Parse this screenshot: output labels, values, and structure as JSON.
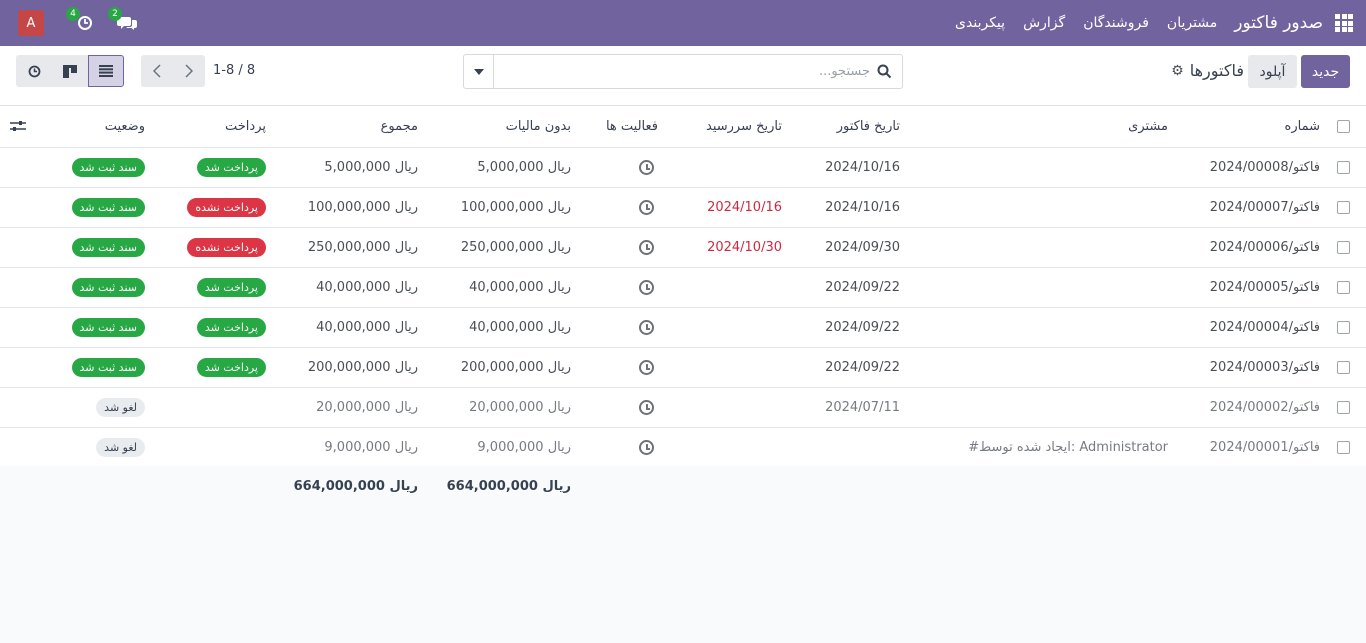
{
  "navbar": {
    "brand": "صدور فاکتور",
    "menu": [
      "مشتریان",
      "فروشندگان",
      "گزارش",
      "پیکربندی"
    ],
    "avatar_letter": "A",
    "activity_count": "4",
    "chat_count": "2",
    "bg_color": "#71639e"
  },
  "control": {
    "new_label": "جدید",
    "upload_label": "آپلود",
    "breadcrumb": "فاکتورها",
    "search_placeholder": "جستجو...",
    "pager": "1-8 / 8"
  },
  "table": {
    "headers": {
      "number": "شماره",
      "customer": "مشتری",
      "invoice_date": "تاریخ فاکتور",
      "due_date": "تاریخ سررسید",
      "activities": "فعالیت ها",
      "untaxed": "بدون مالیات",
      "total": "مجموع",
      "payment": "پرداخت",
      "status": "وضعیت"
    },
    "rows": [
      {
        "number": "فاکتو/2024/00008",
        "customer": "",
        "invoice_date": "2024/10/16",
        "due_date": "",
        "untaxed": "ریال 5,000,000",
        "total": "ریال 5,000,000",
        "payment": "پرداخت شد",
        "status": "سند ثبت شد"
      },
      {
        "number": "فاکتو/2024/00007",
        "customer": "",
        "invoice_date": "2024/10/16",
        "due_date": "2024/10/16",
        "untaxed": "ریال 100,000,000",
        "total": "ریال 100,000,000",
        "payment": "پرداخت نشده",
        "status": "سند ثبت شد"
      },
      {
        "number": "فاکتو/2024/00006",
        "customer": "",
        "invoice_date": "2024/09/30",
        "due_date": "2024/10/30",
        "untaxed": "ریال 250,000,000",
        "total": "ریال 250,000,000",
        "payment": "پرداخت نشده",
        "status": "سند ثبت شد"
      },
      {
        "number": "فاکتو/2024/00005",
        "customer": "",
        "invoice_date": "2024/09/22",
        "due_date": "",
        "untaxed": "ریال 40,000,000",
        "total": "ریال 40,000,000",
        "payment": "پرداخت شد",
        "status": "سند ثبت شد"
      },
      {
        "number": "فاکتو/2024/00004",
        "customer": "",
        "invoice_date": "2024/09/22",
        "due_date": "",
        "untaxed": "ریال 40,000,000",
        "total": "ریال 40,000,000",
        "payment": "پرداخت شد",
        "status": "سند ثبت شد"
      },
      {
        "number": "فاکتو/2024/00003",
        "customer": "",
        "invoice_date": "2024/09/22",
        "due_date": "",
        "untaxed": "ریال 200,000,000",
        "total": "ریال 200,000,000",
        "payment": "پرداخت شد",
        "status": "سند ثبت شد"
      },
      {
        "number": "فاکتو/2024/00002",
        "customer": "",
        "invoice_date": "2024/07/11",
        "due_date": "",
        "untaxed": "ریال 20,000,000",
        "total": "ریال 20,000,000",
        "payment": "",
        "status": "لغو شد"
      },
      {
        "number": "فاکتو/2024/00001",
        "customer": "#ایجاد شده توسط: Administrator",
        "invoice_date": "",
        "due_date": "",
        "untaxed": "ریال 9,000,000",
        "total": "ریال 9,000,000",
        "payment": "",
        "status": "لغو شد"
      }
    ],
    "totals": {
      "untaxed": "ریال 664,000,000",
      "total": "ریال 664,000,000"
    }
  }
}
